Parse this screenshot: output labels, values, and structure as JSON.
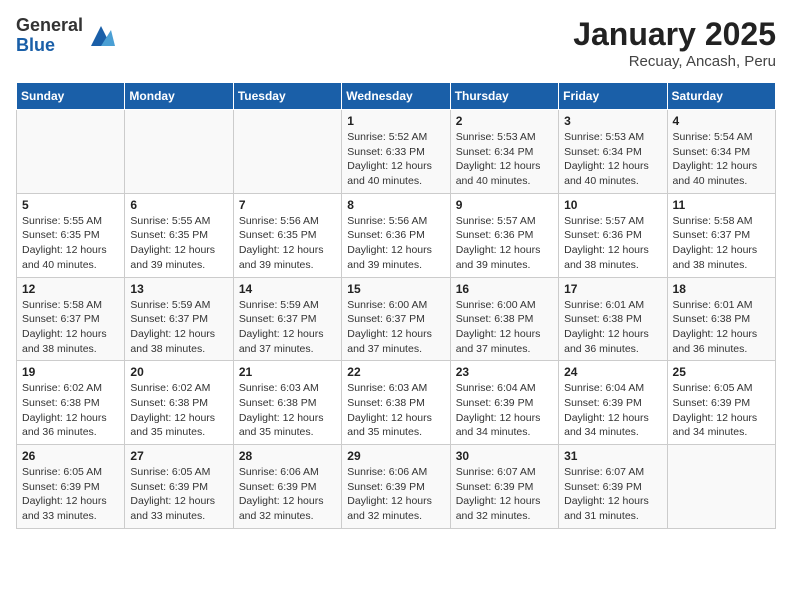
{
  "logo": {
    "general": "General",
    "blue": "Blue"
  },
  "title": "January 2025",
  "subtitle": "Recuay, Ancash, Peru",
  "weekdays": [
    "Sunday",
    "Monday",
    "Tuesday",
    "Wednesday",
    "Thursday",
    "Friday",
    "Saturday"
  ],
  "weeks": [
    [
      {
        "day": "",
        "info": ""
      },
      {
        "day": "",
        "info": ""
      },
      {
        "day": "",
        "info": ""
      },
      {
        "day": "1",
        "info": "Sunrise: 5:52 AM\nSunset: 6:33 PM\nDaylight: 12 hours\nand 40 minutes."
      },
      {
        "day": "2",
        "info": "Sunrise: 5:53 AM\nSunset: 6:34 PM\nDaylight: 12 hours\nand 40 minutes."
      },
      {
        "day": "3",
        "info": "Sunrise: 5:53 AM\nSunset: 6:34 PM\nDaylight: 12 hours\nand 40 minutes."
      },
      {
        "day": "4",
        "info": "Sunrise: 5:54 AM\nSunset: 6:34 PM\nDaylight: 12 hours\nand 40 minutes."
      }
    ],
    [
      {
        "day": "5",
        "info": "Sunrise: 5:55 AM\nSunset: 6:35 PM\nDaylight: 12 hours\nand 40 minutes."
      },
      {
        "day": "6",
        "info": "Sunrise: 5:55 AM\nSunset: 6:35 PM\nDaylight: 12 hours\nand 39 minutes."
      },
      {
        "day": "7",
        "info": "Sunrise: 5:56 AM\nSunset: 6:35 PM\nDaylight: 12 hours\nand 39 minutes."
      },
      {
        "day": "8",
        "info": "Sunrise: 5:56 AM\nSunset: 6:36 PM\nDaylight: 12 hours\nand 39 minutes."
      },
      {
        "day": "9",
        "info": "Sunrise: 5:57 AM\nSunset: 6:36 PM\nDaylight: 12 hours\nand 39 minutes."
      },
      {
        "day": "10",
        "info": "Sunrise: 5:57 AM\nSunset: 6:36 PM\nDaylight: 12 hours\nand 38 minutes."
      },
      {
        "day": "11",
        "info": "Sunrise: 5:58 AM\nSunset: 6:37 PM\nDaylight: 12 hours\nand 38 minutes."
      }
    ],
    [
      {
        "day": "12",
        "info": "Sunrise: 5:58 AM\nSunset: 6:37 PM\nDaylight: 12 hours\nand 38 minutes."
      },
      {
        "day": "13",
        "info": "Sunrise: 5:59 AM\nSunset: 6:37 PM\nDaylight: 12 hours\nand 38 minutes."
      },
      {
        "day": "14",
        "info": "Sunrise: 5:59 AM\nSunset: 6:37 PM\nDaylight: 12 hours\nand 37 minutes."
      },
      {
        "day": "15",
        "info": "Sunrise: 6:00 AM\nSunset: 6:37 PM\nDaylight: 12 hours\nand 37 minutes."
      },
      {
        "day": "16",
        "info": "Sunrise: 6:00 AM\nSunset: 6:38 PM\nDaylight: 12 hours\nand 37 minutes."
      },
      {
        "day": "17",
        "info": "Sunrise: 6:01 AM\nSunset: 6:38 PM\nDaylight: 12 hours\nand 36 minutes."
      },
      {
        "day": "18",
        "info": "Sunrise: 6:01 AM\nSunset: 6:38 PM\nDaylight: 12 hours\nand 36 minutes."
      }
    ],
    [
      {
        "day": "19",
        "info": "Sunrise: 6:02 AM\nSunset: 6:38 PM\nDaylight: 12 hours\nand 36 minutes."
      },
      {
        "day": "20",
        "info": "Sunrise: 6:02 AM\nSunset: 6:38 PM\nDaylight: 12 hours\nand 35 minutes."
      },
      {
        "day": "21",
        "info": "Sunrise: 6:03 AM\nSunset: 6:38 PM\nDaylight: 12 hours\nand 35 minutes."
      },
      {
        "day": "22",
        "info": "Sunrise: 6:03 AM\nSunset: 6:38 PM\nDaylight: 12 hours\nand 35 minutes."
      },
      {
        "day": "23",
        "info": "Sunrise: 6:04 AM\nSunset: 6:39 PM\nDaylight: 12 hours\nand 34 minutes."
      },
      {
        "day": "24",
        "info": "Sunrise: 6:04 AM\nSunset: 6:39 PM\nDaylight: 12 hours\nand 34 minutes."
      },
      {
        "day": "25",
        "info": "Sunrise: 6:05 AM\nSunset: 6:39 PM\nDaylight: 12 hours\nand 34 minutes."
      }
    ],
    [
      {
        "day": "26",
        "info": "Sunrise: 6:05 AM\nSunset: 6:39 PM\nDaylight: 12 hours\nand 33 minutes."
      },
      {
        "day": "27",
        "info": "Sunrise: 6:05 AM\nSunset: 6:39 PM\nDaylight: 12 hours\nand 33 minutes."
      },
      {
        "day": "28",
        "info": "Sunrise: 6:06 AM\nSunset: 6:39 PM\nDaylight: 12 hours\nand 32 minutes."
      },
      {
        "day": "29",
        "info": "Sunrise: 6:06 AM\nSunset: 6:39 PM\nDaylight: 12 hours\nand 32 minutes."
      },
      {
        "day": "30",
        "info": "Sunrise: 6:07 AM\nSunset: 6:39 PM\nDaylight: 12 hours\nand 32 minutes."
      },
      {
        "day": "31",
        "info": "Sunrise: 6:07 AM\nSunset: 6:39 PM\nDaylight: 12 hours\nand 31 minutes."
      },
      {
        "day": "",
        "info": ""
      }
    ]
  ]
}
